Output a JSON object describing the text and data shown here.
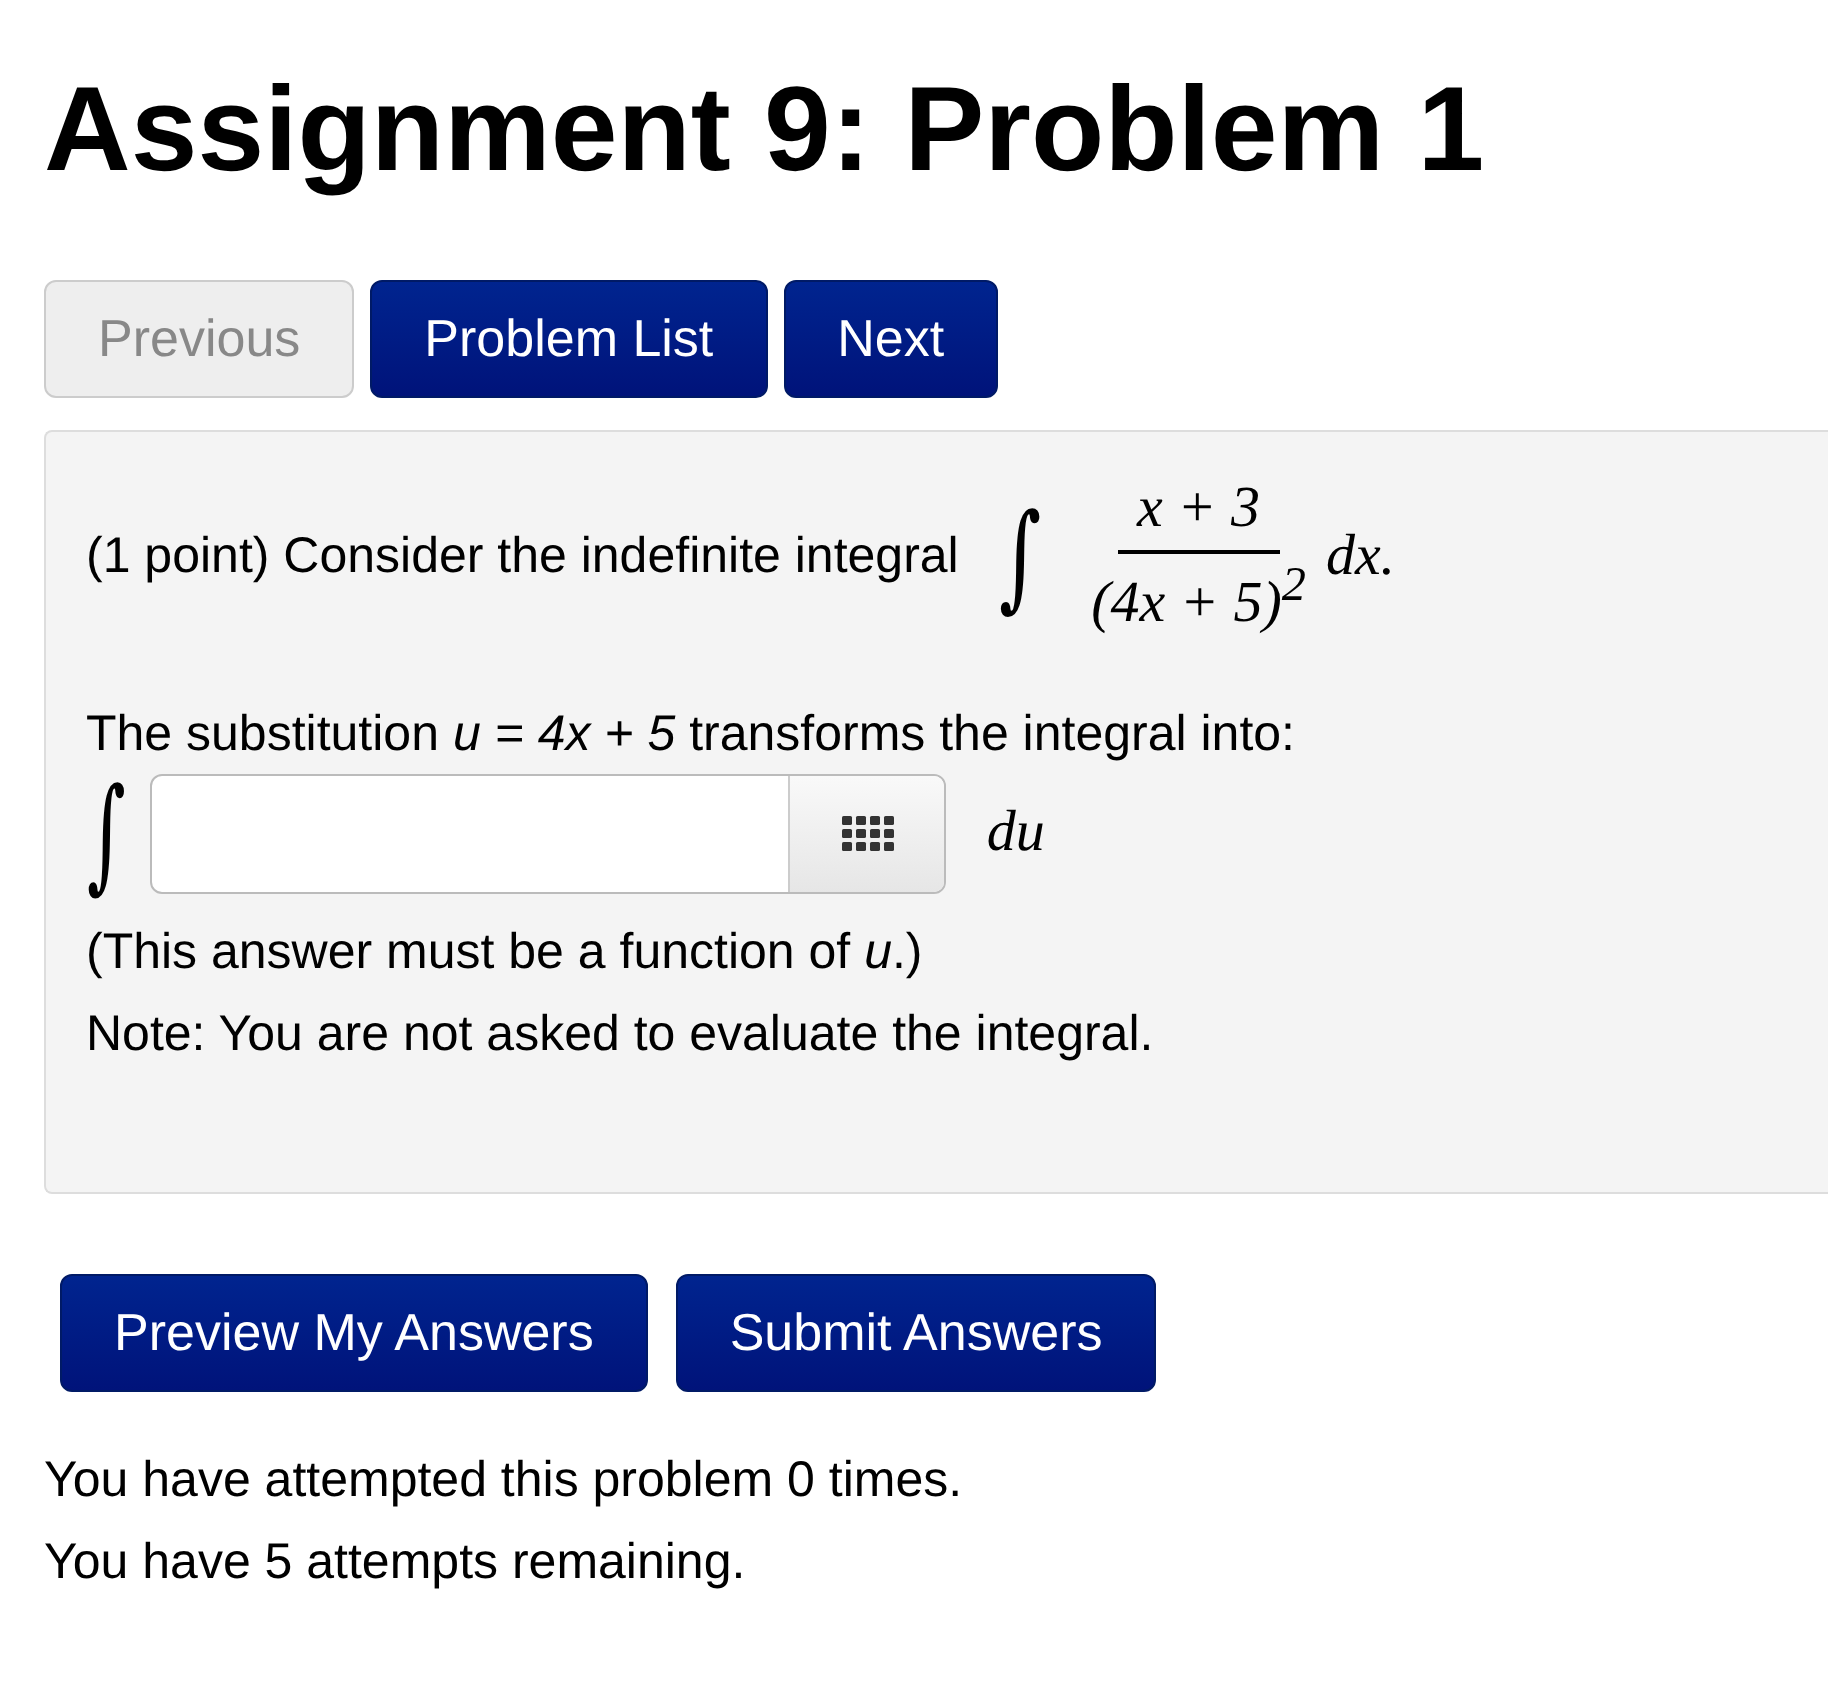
{
  "page": {
    "title": "Assignment 9: Problem 1"
  },
  "nav_buttons": [
    {
      "label": "Previous",
      "disabled": true
    },
    {
      "label": "Problem List",
      "disabled": false
    },
    {
      "label": "Next",
      "disabled": false
    }
  ],
  "problem": {
    "intro": "(1 point) Consider the indefinite integral",
    "integral": {
      "sign": "∫",
      "numerator": "x + 3",
      "denominator": "(4x + 5)$^{2}$",
      "differential": "dx."
    },
    "substitution": "The substitution *u = 4x + 5* transforms the integral into:",
    "answer": {
      "sign": "∫",
      "differential": "du"
    },
    "notes": [
      "(This answer must be a function of *u*.)",
      "Note: You are not asked to evaluate the integral."
    ]
  },
  "action_buttons": [
    "Preview My Answers",
    "Submit Answers"
  ],
  "attempts": [
    "You have attempted this problem 0 times.",
    "You have 5 attempts remaining."
  ]
}
